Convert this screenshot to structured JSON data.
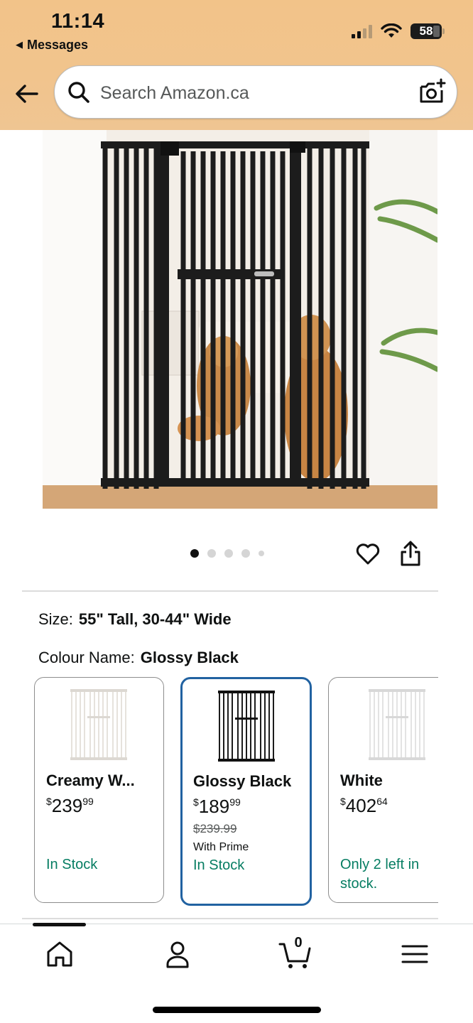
{
  "status_bar": {
    "time": "11:14",
    "back_app": "Messages",
    "battery": "58",
    "icons": [
      "cellular-signal-icon",
      "wifi-icon",
      "battery-icon"
    ]
  },
  "header": {
    "search_placeholder": "Search Amazon.ca",
    "icons": [
      "back-arrow-icon",
      "search-icon",
      "camera-icon"
    ],
    "background_color": "#f2c389"
  },
  "gallery": {
    "image_count": 5,
    "active_index": 0,
    "icons": [
      "heart-icon",
      "share-icon"
    ]
  },
  "product": {
    "size_label": "Size:",
    "size_value": "55\" Tall, 30-44\" Wide",
    "colour_label": "Colour Name:",
    "colour_value": "Glossy Black"
  },
  "swatches": [
    {
      "name": "Creamy W...",
      "currency": "$",
      "price_whole": "239",
      "price_fraction": "99",
      "was": "",
      "prime": "",
      "stock": "In Stock",
      "selected": false
    },
    {
      "name": "Glossy Black",
      "currency": "$",
      "price_whole": "189",
      "price_fraction": "99",
      "was": "$239.99",
      "prime": "With Prime",
      "stock": "In Stock",
      "selected": true
    },
    {
      "name": "White",
      "currency": "$",
      "price_whole": "402",
      "price_fraction": "64",
      "was": "",
      "prime": "",
      "stock": "Only 2 left in stock.",
      "selected": false
    }
  ],
  "tabbar": {
    "cart_count": "0",
    "tabs": [
      "home-icon",
      "account-icon",
      "cart-icon",
      "menu-icon"
    ]
  },
  "colors": {
    "stock_green": "#067d62",
    "selected_border": "#2162a1"
  }
}
